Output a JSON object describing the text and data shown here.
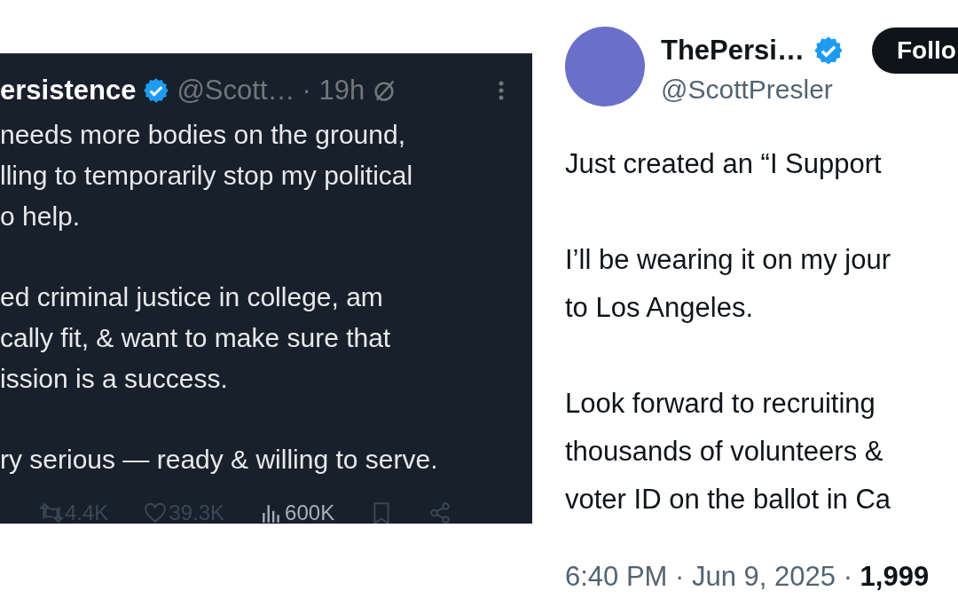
{
  "left_post": {
    "author": "ersistence",
    "verified": true,
    "handle": "@Scott…",
    "time": "· 19h",
    "paragraphs": [
      [
        "needs more bodies on the ground,",
        "lling to temporarily stop my political",
        "o help."
      ],
      [
        "ed criminal justice in college, am",
        "cally fit, & want to make sure that",
        "ission is a success."
      ],
      [
        "ry serious — ready & willing to serve."
      ]
    ],
    "stats": [
      {
        "kind": "retweet",
        "count": "4.4K"
      },
      {
        "kind": "like",
        "count": "39.3K"
      },
      {
        "kind": "views",
        "count": "600K"
      },
      {
        "kind": "bookmark"
      },
      {
        "kind": "share"
      }
    ]
  },
  "right_post": {
    "author": "ThePersi…",
    "verified": true,
    "handle": "@ScottPresler",
    "follow_button": "Follo",
    "paragraphs": [
      [
        "Just created an “I Support"
      ],
      [
        "I’ll be wearing it on my jour",
        "to Los Angeles."
      ],
      [
        "Look forward to recruiting",
        "thousands of volunteers &",
        "voter ID on the ballot in Ca"
      ]
    ],
    "timestamp": "6:40 PM · Jun 9, 2025 · ",
    "views": "1,999"
  }
}
